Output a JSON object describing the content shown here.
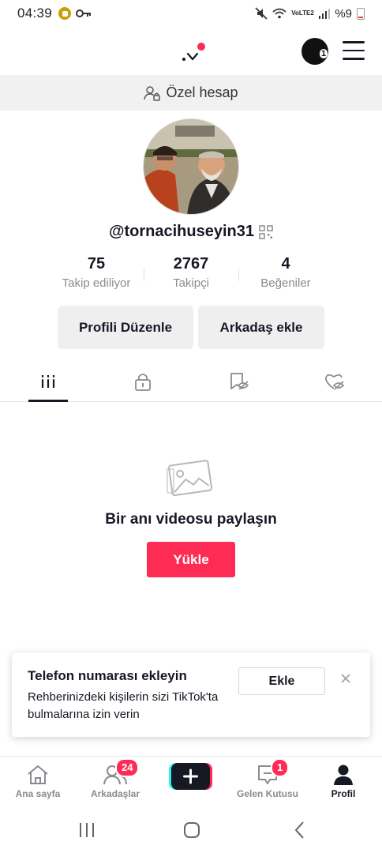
{
  "status_bar": {
    "time": "04:39",
    "battery_text": "%9",
    "network": "VoLTE2",
    "icons": [
      "coin-icon",
      "key-icon",
      "mute-icon",
      "wifi-icon",
      "signal-icon",
      "battery-icon"
    ]
  },
  "header": {
    "avatar_badge": "1",
    "icons": [
      "switch-account-icon",
      "menu-icon"
    ]
  },
  "private_banner": {
    "label": "Özel hesap",
    "icon": "private-account-icon"
  },
  "profile": {
    "username": "@tornacihuseyin31",
    "stats": [
      {
        "value": "75",
        "label": "Takip ediliyor"
      },
      {
        "value": "2767",
        "label": "Takipçi"
      },
      {
        "value": "4",
        "label": "Beğeniler"
      }
    ],
    "buttons": {
      "edit": "Profili Düzenle",
      "add_friend": "Arkadaş ekle"
    }
  },
  "tabs": [
    {
      "icon": "videos-grid-icon",
      "active": true
    },
    {
      "icon": "lock-icon",
      "active": false
    },
    {
      "icon": "favorites-hidden-icon",
      "active": false
    },
    {
      "icon": "liked-hidden-icon",
      "active": false
    }
  ],
  "empty_state": {
    "title": "Bir anı videosu paylaşın",
    "button": "Yükle"
  },
  "phone_card": {
    "title": "Telefon numarası ekleyin",
    "description": "Rehberinizdeki kişilerin sizi TikTok'ta bulmalarına izin verin",
    "button": "Ekle"
  },
  "bottom_nav": {
    "home": "Ana sayfa",
    "friends": "Arkadaşlar",
    "friends_badge": "24",
    "inbox": "Gelen Kutusu",
    "inbox_badge": "1",
    "profile": "Profil"
  },
  "colors": {
    "accent": "#fe2c55",
    "text": "#161823",
    "muted": "#8a8b91",
    "banner_bg": "#f1f1f2"
  }
}
